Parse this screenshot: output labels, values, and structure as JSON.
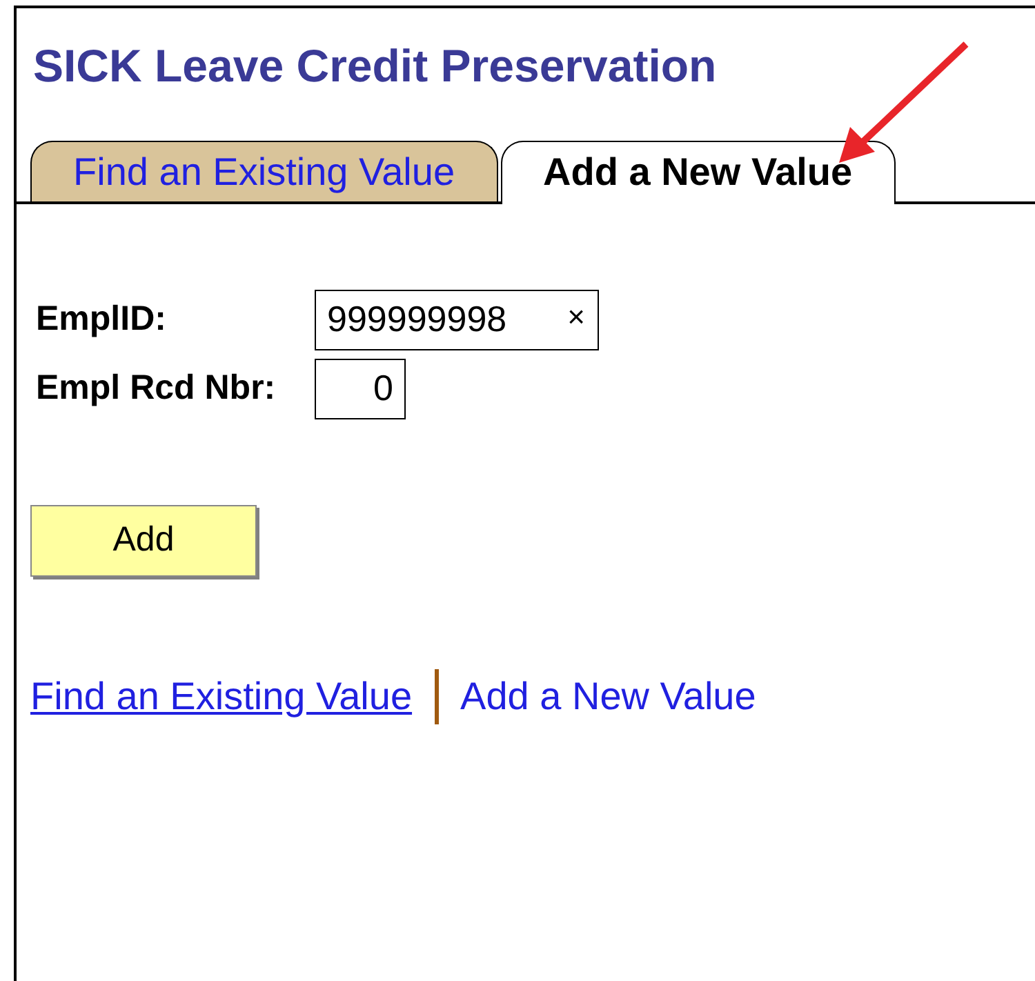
{
  "page": {
    "title": "SICK Leave Credit Preservation"
  },
  "tabs": [
    {
      "label": "Find an Existing Value",
      "selected": false
    },
    {
      "label": "Add a New Value",
      "selected": true
    }
  ],
  "fields": [
    {
      "label": "EmplID:",
      "value": "999999998",
      "clear_icon": "×"
    },
    {
      "label": "Empl Rcd Nbr:",
      "value": "0"
    }
  ],
  "button": "Add",
  "links": [
    {
      "label": "Find an Existing Value",
      "selected": false
    },
    {
      "label": "Add a New Value",
      "selected": true
    }
  ]
}
